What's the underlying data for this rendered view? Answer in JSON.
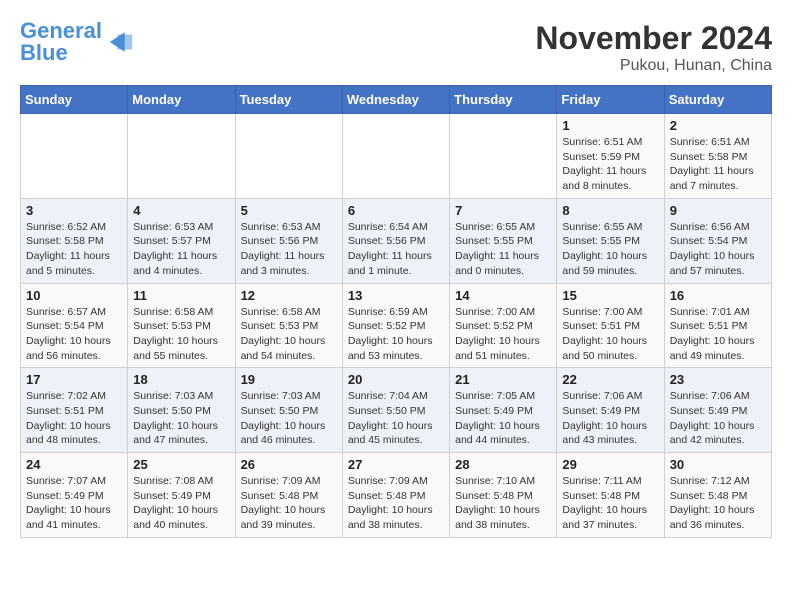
{
  "logo": {
    "general": "General",
    "blue": "Blue"
  },
  "title": "November 2024",
  "location": "Pukou, Hunan, China",
  "days_header": [
    "Sunday",
    "Monday",
    "Tuesday",
    "Wednesday",
    "Thursday",
    "Friday",
    "Saturday"
  ],
  "weeks": [
    [
      {
        "day": "",
        "info": ""
      },
      {
        "day": "",
        "info": ""
      },
      {
        "day": "",
        "info": ""
      },
      {
        "day": "",
        "info": ""
      },
      {
        "day": "",
        "info": ""
      },
      {
        "day": "1",
        "info": "Sunrise: 6:51 AM\nSunset: 5:59 PM\nDaylight: 11 hours\nand 8 minutes."
      },
      {
        "day": "2",
        "info": "Sunrise: 6:51 AM\nSunset: 5:58 PM\nDaylight: 11 hours\nand 7 minutes."
      }
    ],
    [
      {
        "day": "3",
        "info": "Sunrise: 6:52 AM\nSunset: 5:58 PM\nDaylight: 11 hours\nand 5 minutes."
      },
      {
        "day": "4",
        "info": "Sunrise: 6:53 AM\nSunset: 5:57 PM\nDaylight: 11 hours\nand 4 minutes."
      },
      {
        "day": "5",
        "info": "Sunrise: 6:53 AM\nSunset: 5:56 PM\nDaylight: 11 hours\nand 3 minutes."
      },
      {
        "day": "6",
        "info": "Sunrise: 6:54 AM\nSunset: 5:56 PM\nDaylight: 11 hours\nand 1 minute."
      },
      {
        "day": "7",
        "info": "Sunrise: 6:55 AM\nSunset: 5:55 PM\nDaylight: 11 hours\nand 0 minutes."
      },
      {
        "day": "8",
        "info": "Sunrise: 6:55 AM\nSunset: 5:55 PM\nDaylight: 10 hours\nand 59 minutes."
      },
      {
        "day": "9",
        "info": "Sunrise: 6:56 AM\nSunset: 5:54 PM\nDaylight: 10 hours\nand 57 minutes."
      }
    ],
    [
      {
        "day": "10",
        "info": "Sunrise: 6:57 AM\nSunset: 5:54 PM\nDaylight: 10 hours\nand 56 minutes."
      },
      {
        "day": "11",
        "info": "Sunrise: 6:58 AM\nSunset: 5:53 PM\nDaylight: 10 hours\nand 55 minutes."
      },
      {
        "day": "12",
        "info": "Sunrise: 6:58 AM\nSunset: 5:53 PM\nDaylight: 10 hours\nand 54 minutes."
      },
      {
        "day": "13",
        "info": "Sunrise: 6:59 AM\nSunset: 5:52 PM\nDaylight: 10 hours\nand 53 minutes."
      },
      {
        "day": "14",
        "info": "Sunrise: 7:00 AM\nSunset: 5:52 PM\nDaylight: 10 hours\nand 51 minutes."
      },
      {
        "day": "15",
        "info": "Sunrise: 7:00 AM\nSunset: 5:51 PM\nDaylight: 10 hours\nand 50 minutes."
      },
      {
        "day": "16",
        "info": "Sunrise: 7:01 AM\nSunset: 5:51 PM\nDaylight: 10 hours\nand 49 minutes."
      }
    ],
    [
      {
        "day": "17",
        "info": "Sunrise: 7:02 AM\nSunset: 5:51 PM\nDaylight: 10 hours\nand 48 minutes."
      },
      {
        "day": "18",
        "info": "Sunrise: 7:03 AM\nSunset: 5:50 PM\nDaylight: 10 hours\nand 47 minutes."
      },
      {
        "day": "19",
        "info": "Sunrise: 7:03 AM\nSunset: 5:50 PM\nDaylight: 10 hours\nand 46 minutes."
      },
      {
        "day": "20",
        "info": "Sunrise: 7:04 AM\nSunset: 5:50 PM\nDaylight: 10 hours\nand 45 minutes."
      },
      {
        "day": "21",
        "info": "Sunrise: 7:05 AM\nSunset: 5:49 PM\nDaylight: 10 hours\nand 44 minutes."
      },
      {
        "day": "22",
        "info": "Sunrise: 7:06 AM\nSunset: 5:49 PM\nDaylight: 10 hours\nand 43 minutes."
      },
      {
        "day": "23",
        "info": "Sunrise: 7:06 AM\nSunset: 5:49 PM\nDaylight: 10 hours\nand 42 minutes."
      }
    ],
    [
      {
        "day": "24",
        "info": "Sunrise: 7:07 AM\nSunset: 5:49 PM\nDaylight: 10 hours\nand 41 minutes."
      },
      {
        "day": "25",
        "info": "Sunrise: 7:08 AM\nSunset: 5:49 PM\nDaylight: 10 hours\nand 40 minutes."
      },
      {
        "day": "26",
        "info": "Sunrise: 7:09 AM\nSunset: 5:48 PM\nDaylight: 10 hours\nand 39 minutes."
      },
      {
        "day": "27",
        "info": "Sunrise: 7:09 AM\nSunset: 5:48 PM\nDaylight: 10 hours\nand 38 minutes."
      },
      {
        "day": "28",
        "info": "Sunrise: 7:10 AM\nSunset: 5:48 PM\nDaylight: 10 hours\nand 38 minutes."
      },
      {
        "day": "29",
        "info": "Sunrise: 7:11 AM\nSunset: 5:48 PM\nDaylight: 10 hours\nand 37 minutes."
      },
      {
        "day": "30",
        "info": "Sunrise: 7:12 AM\nSunset: 5:48 PM\nDaylight: 10 hours\nand 36 minutes."
      }
    ]
  ]
}
